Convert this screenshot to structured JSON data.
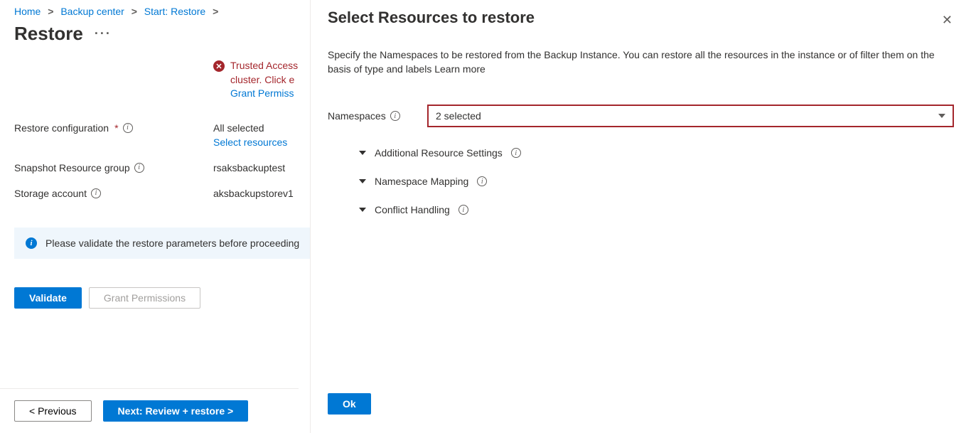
{
  "breadcrumb": {
    "home": "Home",
    "backup_center": "Backup center",
    "start_restore": "Start: Restore"
  },
  "page_title": "Restore",
  "error_banner": {
    "line1": "Trusted Access",
    "line2": "cluster. Click e",
    "link": "Grant Permiss"
  },
  "form": {
    "restore_config_label": "Restore configuration",
    "restore_config_value": "All selected",
    "restore_config_link": "Select resources",
    "snapshot_rg_label": "Snapshot Resource group",
    "snapshot_rg_value": "rsaksbackuptest",
    "storage_account_label": "Storage account",
    "storage_account_value": "aksbackupstorev1"
  },
  "info_bar": "Please validate the restore parameters before proceeding",
  "buttons": {
    "validate": "Validate",
    "grant": "Grant Permissions",
    "previous": "< Previous",
    "next": "Next: Review + restore >"
  },
  "panel": {
    "title": "Select Resources to restore",
    "description": "Specify the Namespaces to be restored from the Backup Instance. You can restore all the resources in the instance or of filter them on the basis of type and labels Learn more",
    "namespaces_label": "Namespaces",
    "namespaces_value": "2 selected",
    "section_additional": "Additional Resource Settings",
    "section_mapping": "Namespace Mapping",
    "section_conflict": "Conflict Handling",
    "ok": "Ok"
  }
}
